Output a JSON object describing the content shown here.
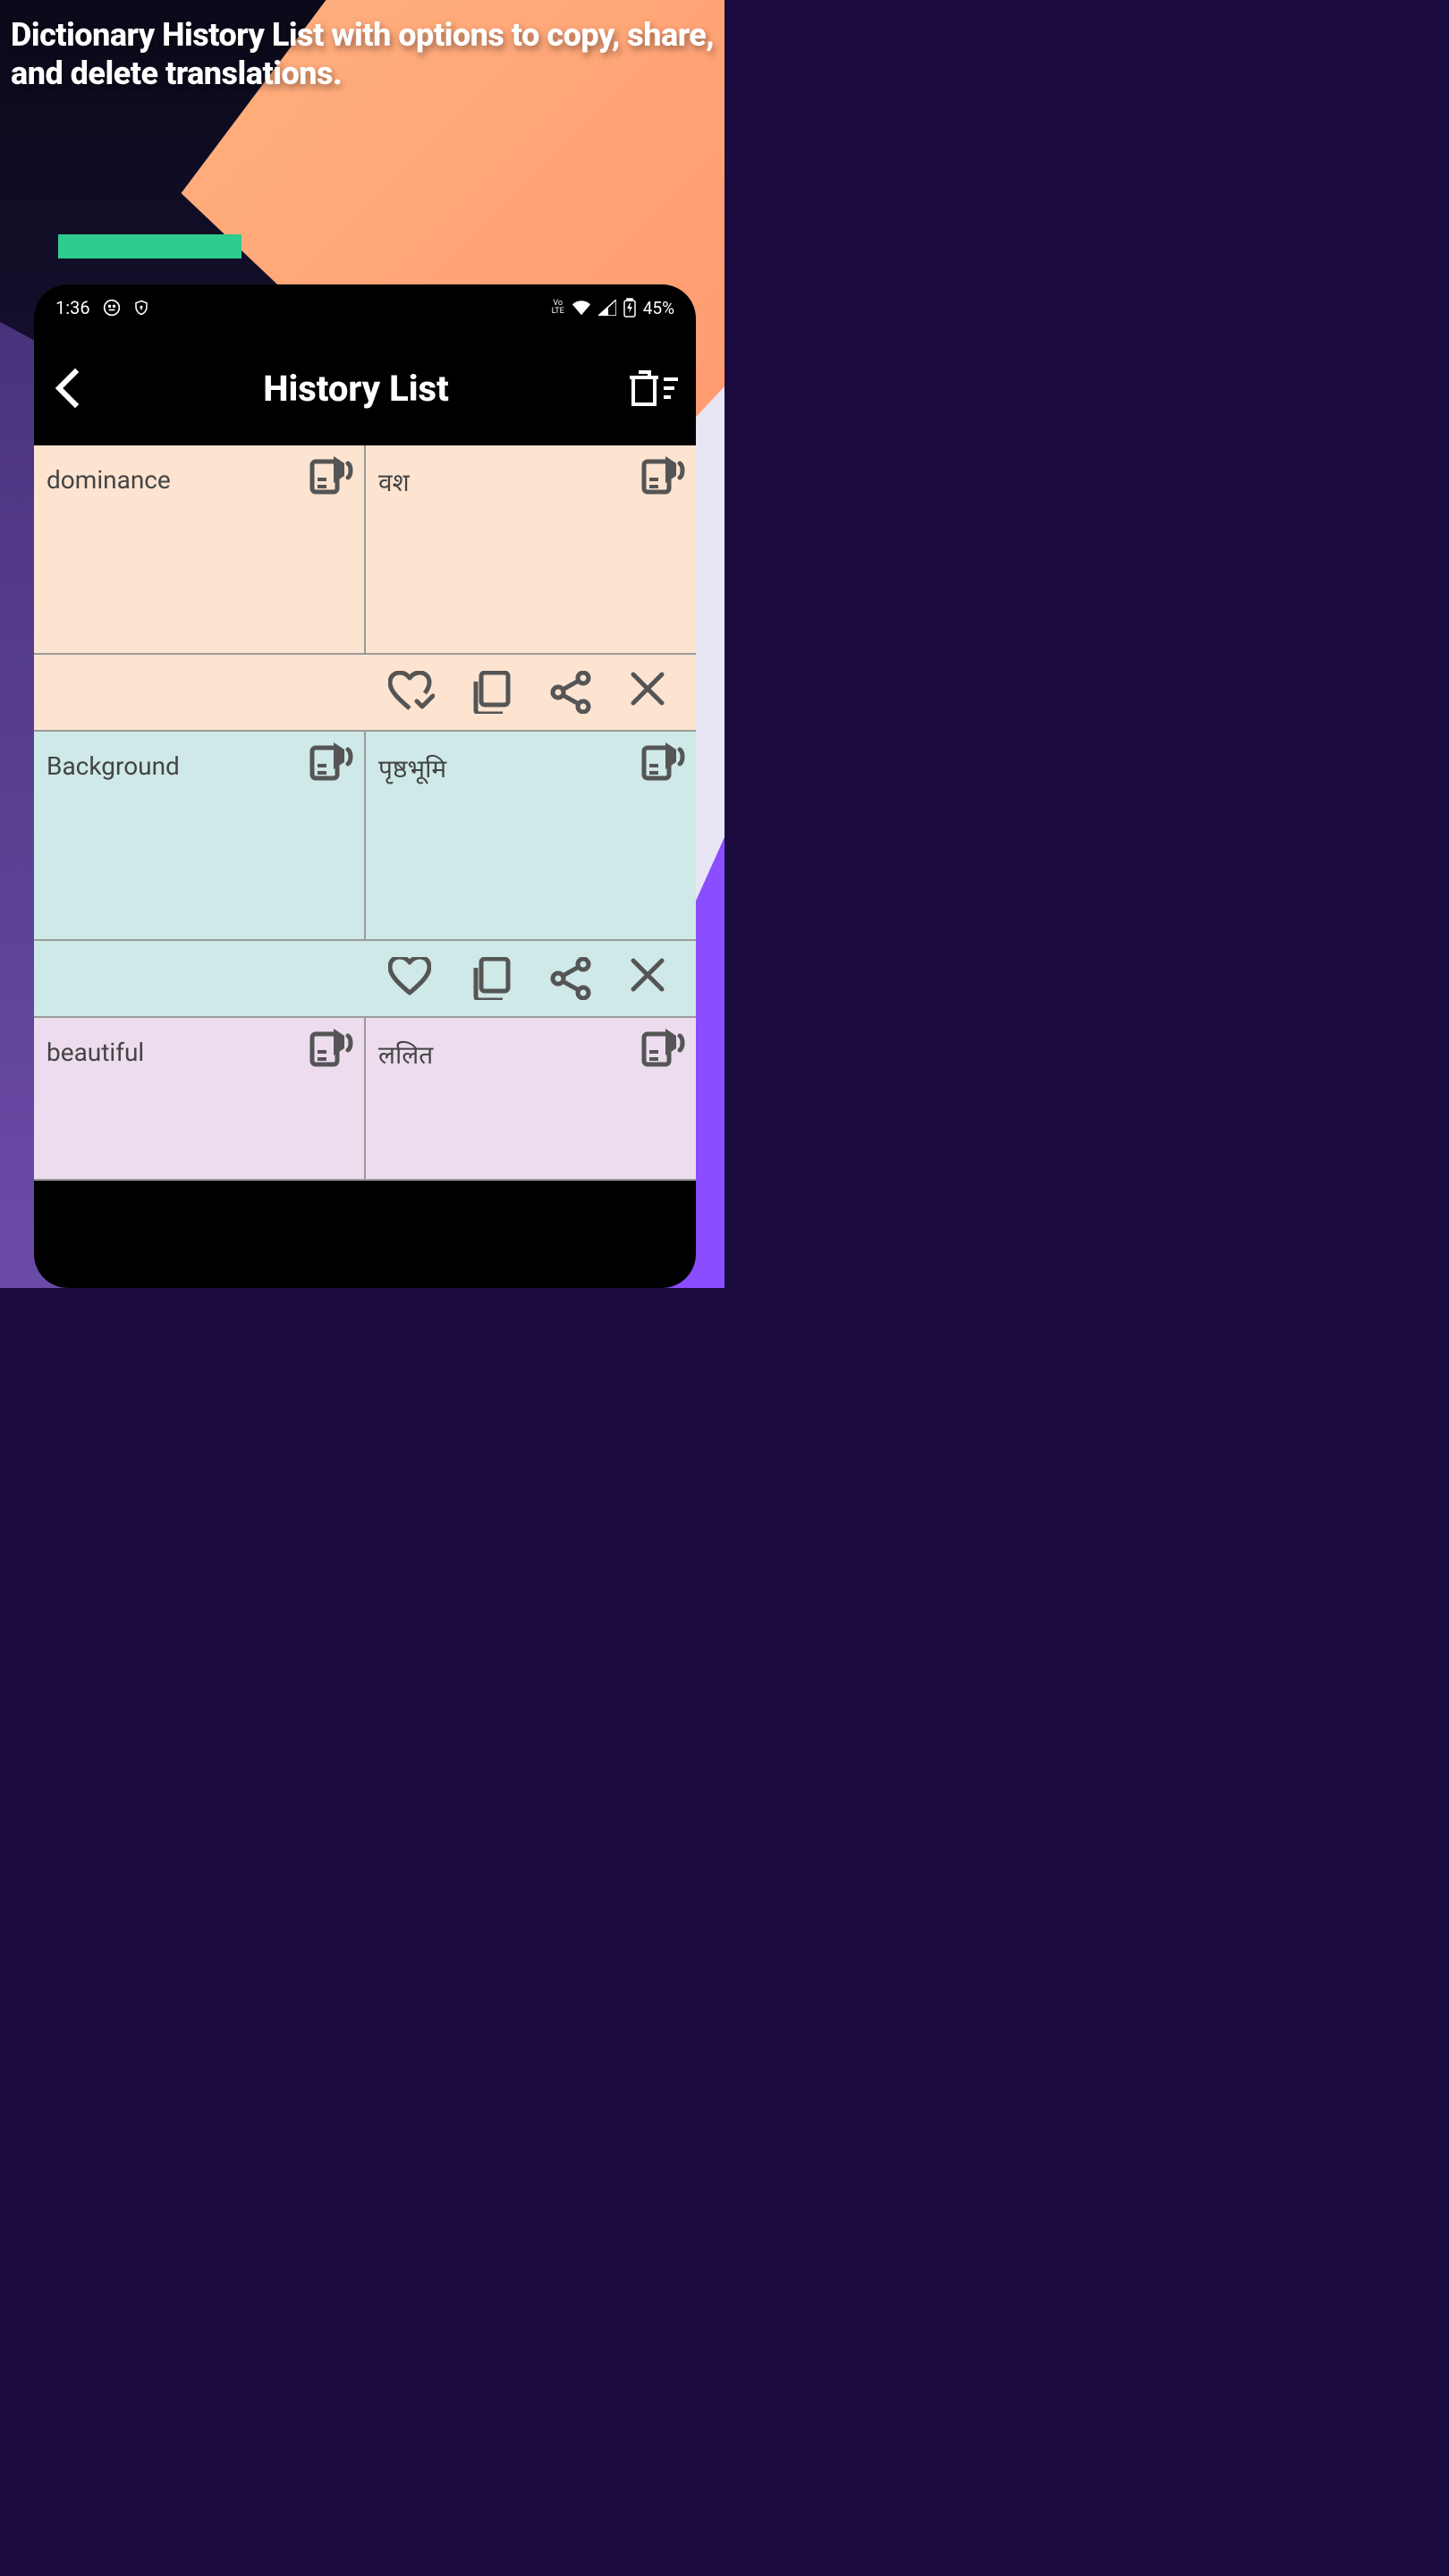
{
  "promo": {
    "text": "Dictionary History List with options to copy, share, and delete translations."
  },
  "status_bar": {
    "time": "1:36",
    "battery": "45%",
    "lte": "Vo»\nLTE"
  },
  "header": {
    "title": "History List"
  },
  "items": [
    {
      "source": "dominance",
      "target": "वश",
      "favorited": true
    },
    {
      "source": "Background",
      "target": "पृष्ठभूमि",
      "favorited": false
    },
    {
      "source": "beautiful",
      "target": "ललित",
      "favorited": false
    }
  ],
  "icons": {
    "back": "back-icon",
    "clear_all": "clear-all-icon",
    "speak": "speak-icon",
    "favorite": "favorite-icon",
    "copy": "copy-icon",
    "share": "share-icon",
    "delete": "delete-icon"
  },
  "colors": {
    "row_1": "#fde4d0",
    "row_2": "#cfe8e8",
    "row_3": "#ecdcee",
    "accent_green": "#2ecc8f",
    "icon": "#555"
  }
}
